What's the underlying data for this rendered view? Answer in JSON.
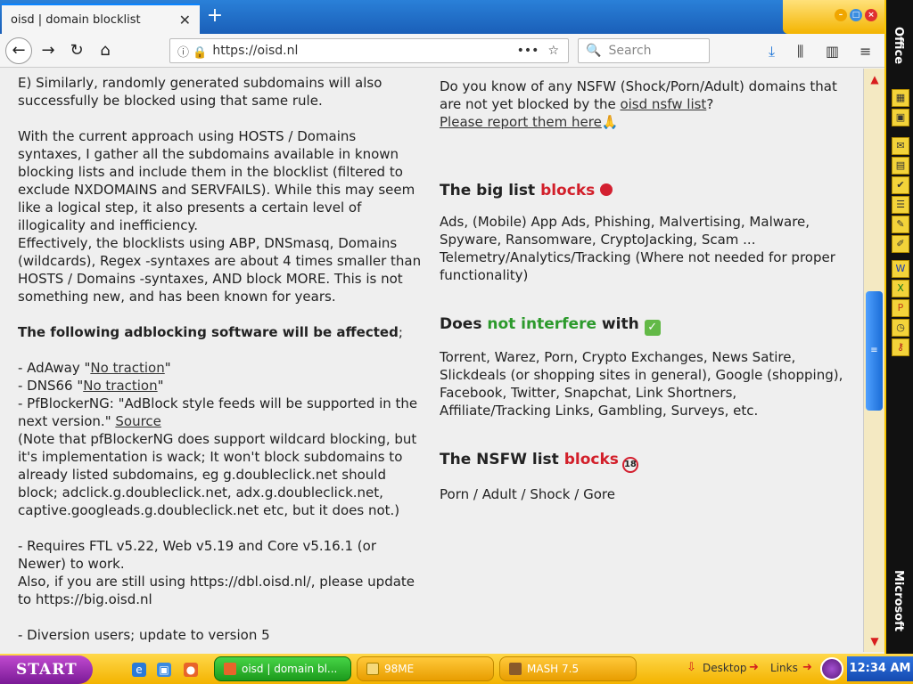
{
  "browser": {
    "tab_title": "oisd | domain blocklist",
    "tab_close": "✕",
    "new_tab": "+",
    "url": "https://oisd.nl",
    "url_more": "•••",
    "url_star": "☆",
    "search_placeholder": "Search"
  },
  "content": {
    "left": {
      "p1": "E) Similarly, randomly generated subdomains will also successfully be blocked using that same rule.",
      "p2a": "With the current approach using HOSTS / Domains syntaxes, I gather all the subdomains available in known blocking lists and include them in the blocklist (filtered to exclude NXDOMAINS and SERVFAILS). While this may seem like a logical step, it also presents a certain level of illogicality and inefficiency.",
      "p2b": "Effectively, the blocklists using ABP, DNSmasq, Domains (wildcards), Regex -syntaxes are about 4 times smaller than HOSTS / Domains -syntaxes, AND block MORE. This is not something new, and has been known for years.",
      "affected_bold": "The following adblocking software will be affected",
      "affected_tail": ";",
      "adaway_prefix": "- AdAway \"",
      "adaway_link": "No traction",
      "adaway_suffix": "\"",
      "dns66_prefix": "- DNS66 \"",
      "dns66_link": "No traction",
      "dns66_suffix": "\"",
      "pfb_text": "- PfBlockerNG: \"AdBlock style feeds will be supported in the next version.\" ",
      "pfb_link": "Source",
      "pfb_note": "(Note that pfBlockerNG does support wildcard blocking, but it's implementation is wack; It won't block subdomains to already listed subdomains, eg g.doubleclick.net should block; adclick.g.doubleclick.net, adx.g.doubleclick.net, captive.googleads.g.doubleclick.net etc, but it does not.)",
      "ftl": "- Requires FTL v5.22, Web v5.19 and Core v5.16.1 (or Newer) to work.",
      "dbl": "Also, if you are still using https://dbl.oisd.nl/, please update to https://big.oisd.nl",
      "diversion": "- Diversion users; update to version 5"
    },
    "right": {
      "nsfw_q_pre": "Do you know of any NSFW (Shock/Porn/Adult) domains that are not yet blocked by the ",
      "nsfw_q_link": "oisd nsfw list",
      "nsfw_q_post": "?",
      "report_link": "Please report them here",
      "report_emoji": "🙏",
      "big_title_pre": "The big list ",
      "big_title_hl": "blocks",
      "big_text": "Ads, (Mobile) App Ads, Phishing, Malvertising, Malware, Spyware, Ransomware, CryptoJacking, Scam ... Telemetry/Analytics/Tracking (Where not needed for proper functionality)",
      "ni_title_pre": "Does ",
      "ni_title_hl": "not interfere",
      "ni_title_post": " with",
      "ni_check": "✓",
      "ni_text": "Torrent, Warez, Porn, Crypto Exchanges, News Satire, Slickdeals (or shopping sites in general), Google (shopping), Facebook, Twitter, Snapchat, Link Shortners, Affiliate/Tracking Links, Gambling, Surveys, etc.",
      "nsfw_title_pre": "The NSFW list ",
      "nsfw_title_hl": "blocks",
      "nsfw_no": "18",
      "nsfw_text": "Porn / Adult / Shock / Gore"
    }
  },
  "officebar": {
    "top_label": "Office",
    "bottom_label": "Microsoft"
  },
  "taskbar": {
    "start_label": "START",
    "tasks": [
      {
        "label": "oisd | domain bl..."
      },
      {
        "label": "98ME"
      },
      {
        "label": "MASH 7.5"
      }
    ],
    "tray_desktop": "Desktop",
    "tray_links": "Links",
    "clock": "12:34 AM"
  },
  "colors": {
    "accent_red": "#d21f2a",
    "accent_green": "#2c9a2c",
    "taskbar_yellow": "#f6c400",
    "start_purple": "#7a1a96"
  }
}
